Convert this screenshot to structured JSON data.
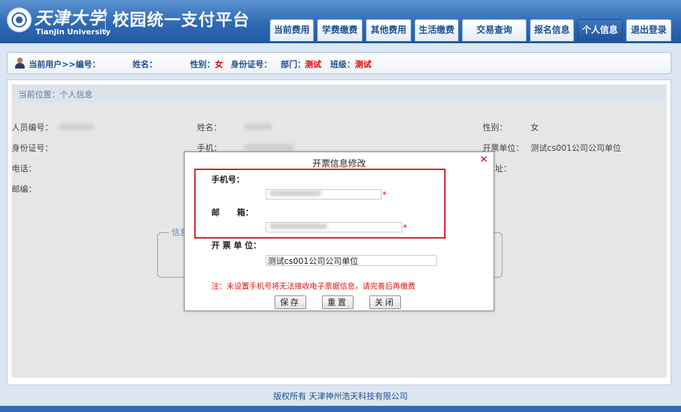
{
  "header": {
    "logo_cn": "天津大学",
    "logo_en": "Tianjin University",
    "system_title": "校园统一支付平台"
  },
  "nav": [
    {
      "label": "当前费用",
      "active": false
    },
    {
      "label": "学费缴费",
      "active": false
    },
    {
      "label": "其他费用",
      "active": false
    },
    {
      "label": "生活缴费",
      "active": false
    },
    {
      "label": "交易查询",
      "active": false
    },
    {
      "label": "报名信息",
      "active": false
    },
    {
      "label": "个人信息",
      "active": true
    },
    {
      "label": "退出登录",
      "active": false
    }
  ],
  "userbar": {
    "current_user_label": "当前用户>>编号：",
    "name_label": "姓名：",
    "gender_label": "性别：",
    "gender_value": "女",
    "id_label": "身份证号：",
    "dept_label": "部门：",
    "dept_value": "测试",
    "class_label": "班级：",
    "class_value": "测试"
  },
  "breadcrumb": "当前位置：个人信息",
  "profile": {
    "staff_no_label": "人员编号：",
    "name_label": "姓名：",
    "gender_label": "性别：",
    "gender_value": "女",
    "id_label": "身份证号：",
    "mobile_label": "手机：",
    "invoice_unit_label": "开票单位：",
    "invoice_unit_value": "测试cs001公司公司单位",
    "phone_label": "电话：",
    "address_tail": "址：",
    "postcode_label": "邮编：",
    "fieldset_legend": "信息"
  },
  "modal": {
    "title": "开票信息修改",
    "close_glyph": "✕",
    "mobile_label": "手机号：",
    "mobile_value": "",
    "email_label": "邮      箱：",
    "email_value": "",
    "unit_label": "开 票 单 位：",
    "unit_value": "测试cs001公司公司单位",
    "required_mark": "*",
    "warning": "注：未设置手机号将无法接收电子票据信息，请完善后再缴费",
    "save_label": "保存",
    "reset_label": "重置",
    "close_label": "关闭"
  },
  "footer": "版权所有 天津神州浩天科技有限公司"
}
